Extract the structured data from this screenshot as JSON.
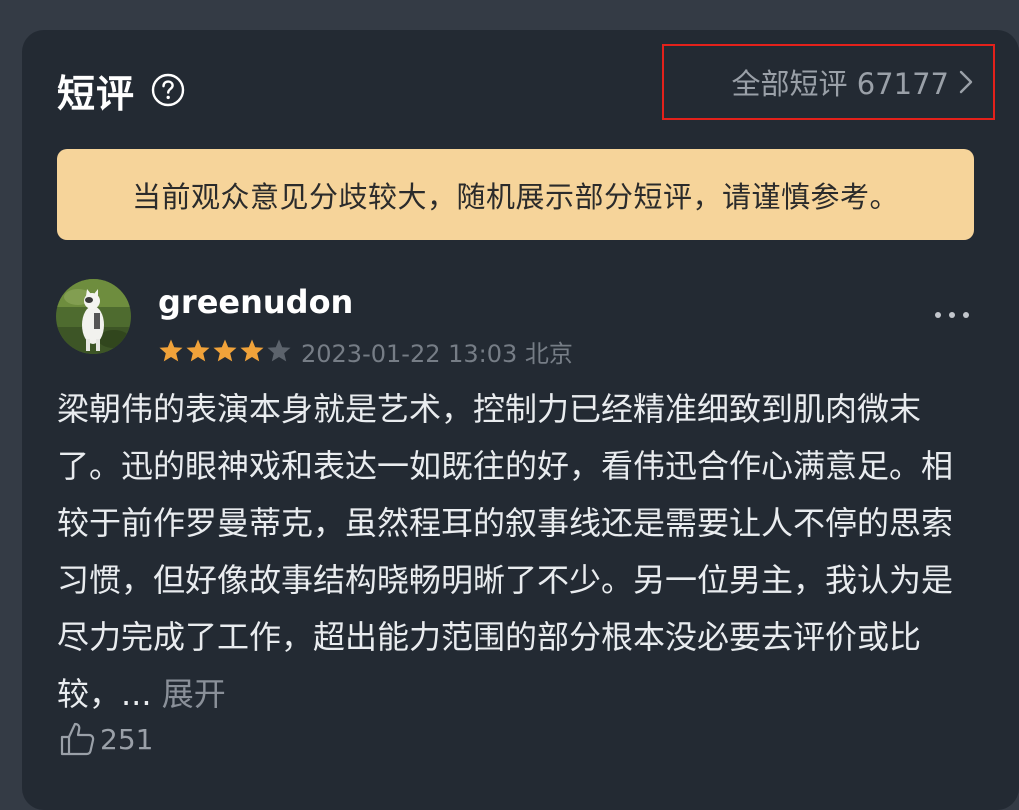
{
  "header": {
    "title": "短评",
    "help_icon": "question-circle-icon",
    "all_reviews_label": "全部短评 67177",
    "chevron_icon": "chevron-right-icon",
    "highlight_color": "#e3211b"
  },
  "notice": {
    "text": "当前观众意见分歧较大，随机展示部分短评，请谨慎参考。",
    "background": "#f6d49a"
  },
  "review": {
    "avatar_icon": "cat-avatar",
    "username": "greenudon",
    "rating": {
      "filled": 4,
      "total": 5,
      "color": "#f0a23a"
    },
    "meta": "2023-01-22 13:03 北京",
    "more_icon": "more-dots-icon",
    "content": "梁朝伟的表演本身就是艺术，控制力已经精准细致到肌肉微末了。迅的眼神戏和表达一如既往的好，看伟迅合作心满意足。相较于前作罗曼蒂克，虽然程耳的叙事线还是需要让人不停的思索习惯，但好像故事结构晓畅明晰了不少。另一位男主，我认为是尽力完成了工作，超出能力范围的部分根本没必要去评价或比较，... ",
    "expand_label": "展开",
    "like_icon": "thumbs-up-icon",
    "like_count": "251"
  }
}
